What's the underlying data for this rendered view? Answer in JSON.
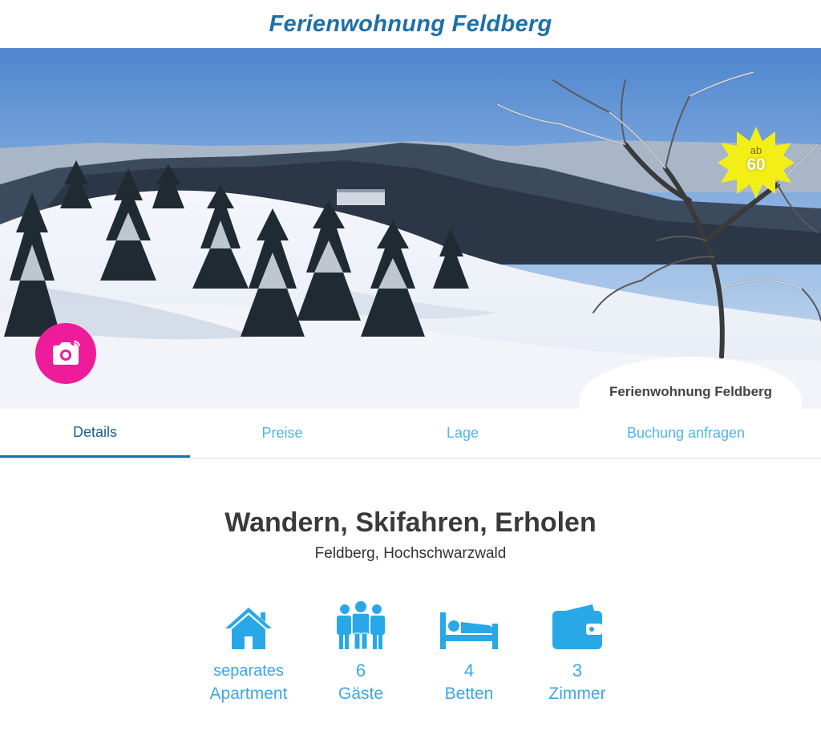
{
  "header": {
    "title": "Ferienwohnung Feldberg"
  },
  "hero": {
    "price_badge": {
      "prefix": "ab",
      "price": "60"
    },
    "caption": "Ferienwohnung Feldberg"
  },
  "tabs": [
    {
      "label": "Details",
      "active": true
    },
    {
      "label": "Preise",
      "active": false
    },
    {
      "label": "Lage",
      "active": false
    },
    {
      "label": "Buchung anfragen",
      "active": false
    }
  ],
  "main": {
    "headline": "Wandern, Skifahren, Erholen",
    "location": "Feldberg, Hochschwarzwald"
  },
  "features": [
    {
      "icon": "house-icon",
      "line1": "separates",
      "line2": "Apartment"
    },
    {
      "icon": "guests-icon",
      "line1": "6",
      "line2": "Gäste"
    },
    {
      "icon": "bed-icon",
      "line1": "4",
      "line2": "Betten"
    },
    {
      "icon": "wallet-icon",
      "line1": "3",
      "line2": "Zimmer"
    }
  ],
  "colors": {
    "title": "#1f6fa8",
    "accent": "#4db5ec",
    "camera": "#ee1c9b",
    "badge": "#f3ee16"
  }
}
